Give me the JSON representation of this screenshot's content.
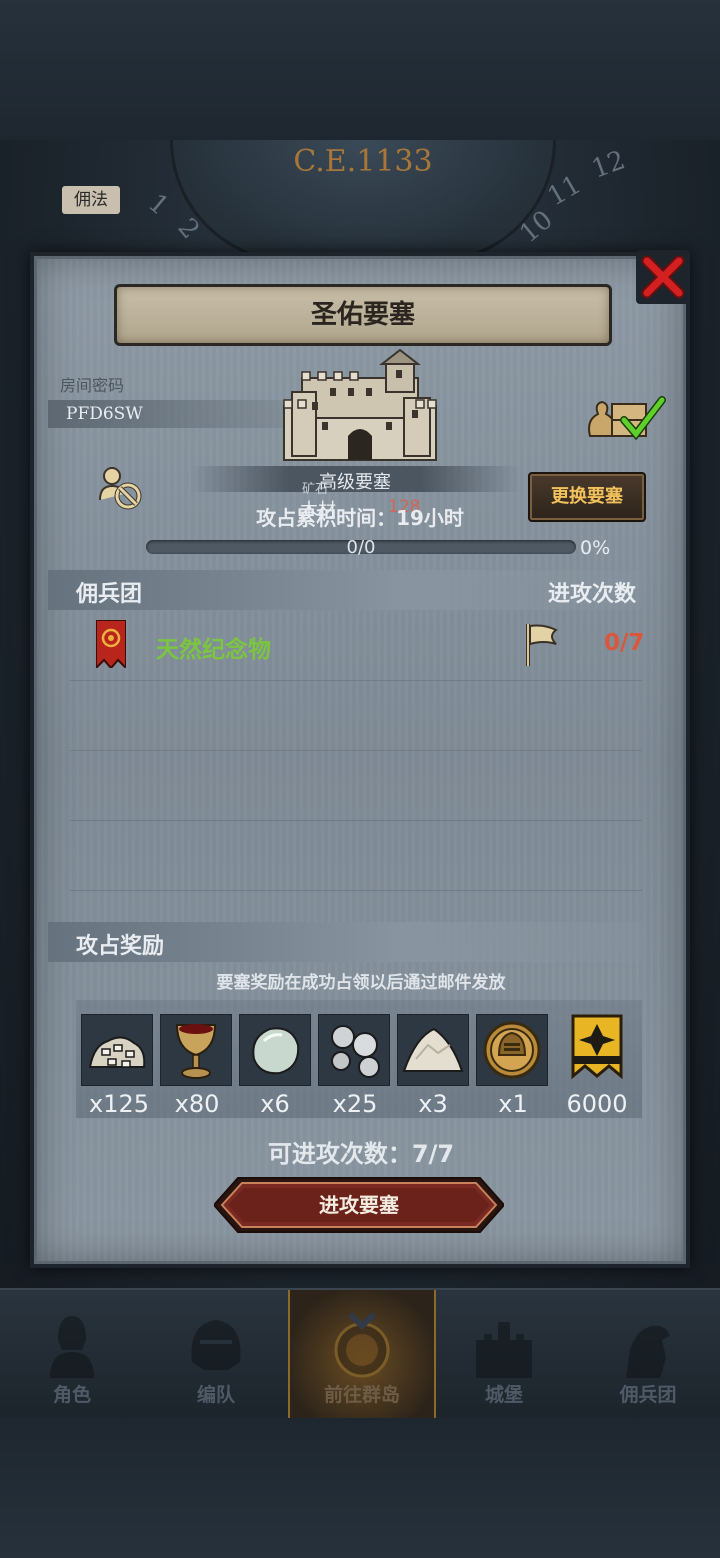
{
  "era": "C.E.1133",
  "side_tag": "佣法",
  "dim_numbers": [
    "11",
    "12",
    "1",
    "2",
    "10"
  ],
  "dialog": {
    "title": "圣佑要塞",
    "room_label": "房间密码",
    "room_code": "PFD6SW",
    "fortress_level": "高级要塞",
    "ore_label": "矿石",
    "resource_name": "木材",
    "resource_amount": "128",
    "attack_time": "攻占累积时间：19小时",
    "change_button": "更换要塞",
    "progress": {
      "text": "0/0",
      "percent_label": "0%",
      "fraction": 0
    },
    "mercenary_section": "佣兵团",
    "attack_count_header": "进攻次数",
    "mercenaries": [
      {
        "name": "天然纪念物",
        "count": "0/7"
      }
    ],
    "reward_section": "攻占奖励",
    "reward_note": "要塞奖励在成功占领以后通过邮件发放",
    "rewards": [
      {
        "icon": "ore-pile-icon",
        "qty": "x125"
      },
      {
        "icon": "goblet-icon",
        "qty": "x80"
      },
      {
        "icon": "pale-stone-icon",
        "qty": "x6"
      },
      {
        "icon": "silver-ore-icon",
        "qty": "x25"
      },
      {
        "icon": "salt-pile-icon",
        "qty": "x3"
      },
      {
        "icon": "knight-helmet-coin-icon",
        "qty": "x1"
      },
      {
        "icon": "guild-banner-icon",
        "qty": "6000"
      }
    ],
    "attacks_left": "可进攻次数：7/7",
    "attack_button": "进攻要塞"
  },
  "nav": {
    "items": [
      {
        "label": "角色",
        "icon": "knight-icon"
      },
      {
        "label": "编队",
        "icon": "helmet-icon"
      },
      {
        "label": "前往群岛",
        "icon": "compass-map-icon",
        "active": true
      },
      {
        "label": "城堡",
        "icon": "castle-icon"
      },
      {
        "label": "佣兵团",
        "icon": "horse-knight-icon"
      }
    ]
  },
  "colors": {
    "accent_gold": "#f2c15c",
    "merc_green": "#7bc542",
    "alert_red": "#d9573d",
    "close_red": "#d42020"
  }
}
